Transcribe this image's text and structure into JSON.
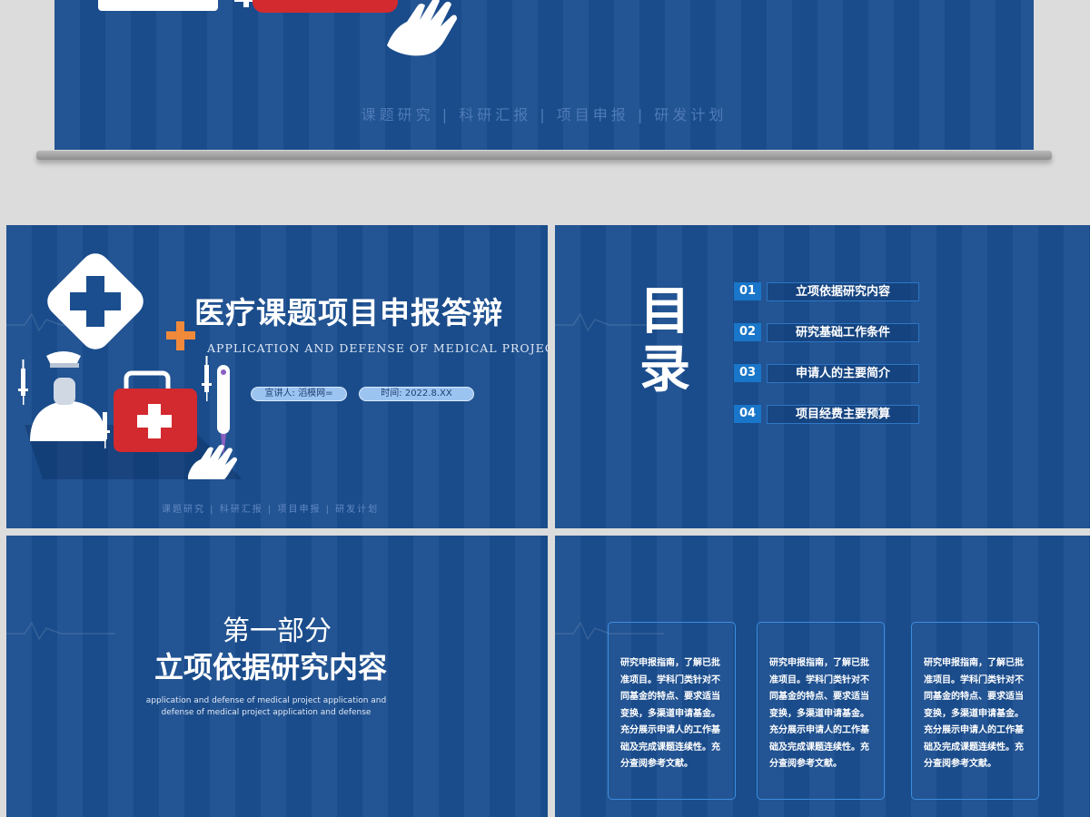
{
  "top_slide": {
    "tagline": "课题研究 | 科研汇报 | 项目申报 | 研发计划"
  },
  "title_slide": {
    "title": "医疗课题项目申报答辩",
    "subtitle": "APPLICATION AND DEFENSE OF MEDICAL PROJECT",
    "speaker": "宣讲人: 滔模网=",
    "time": "时间: 2022.8.XX",
    "tagline": "课题研究 | 科研汇报 | 项目申报 | 研发计划"
  },
  "toc_slide": {
    "heading_line1": "目",
    "heading_line2": "录",
    "items": [
      {
        "num": "01",
        "label": "立项依据研究内容"
      },
      {
        "num": "02",
        "label": "研究基础工作条件"
      },
      {
        "num": "03",
        "label": "申请人的主要简介"
      },
      {
        "num": "04",
        "label": "项目经费主要预算"
      }
    ]
  },
  "section_slide": {
    "part": "第一部分",
    "title": "立项依据研究内容",
    "english": "application and defense of medical project application and defense of medical project application and defense"
  },
  "content_slide": {
    "cards": [
      {
        "text": "研究申报指南，了解已批准项目。学科门类针对不同基金的特点、要求适当变换，多渠道申请基金。充分展示申请人的工作基础及完成课题连续性。充分查阅参考文献。"
      },
      {
        "text": "研究申报指南，了解已批准项目。学科门类针对不同基金的特点、要求适当变换，多渠道申请基金。充分展示申请人的工作基础及完成课题连续性。充分查阅参考文献。"
      },
      {
        "text": "研究申报指南，了解已批准项目。学科门类针对不同基金的特点、要求适当变换，多渠道申请基金。充分展示申请人的工作基础及完成课题连续性。充分查阅参考文献。"
      }
    ]
  },
  "colors": {
    "slide_bg": "#1b4e8f",
    "medical_red": "#d22a2f",
    "accent_orange": "#f08a3a",
    "accent_purple": "#8a5fc0",
    "toc_num_bg": "#1976c9"
  }
}
